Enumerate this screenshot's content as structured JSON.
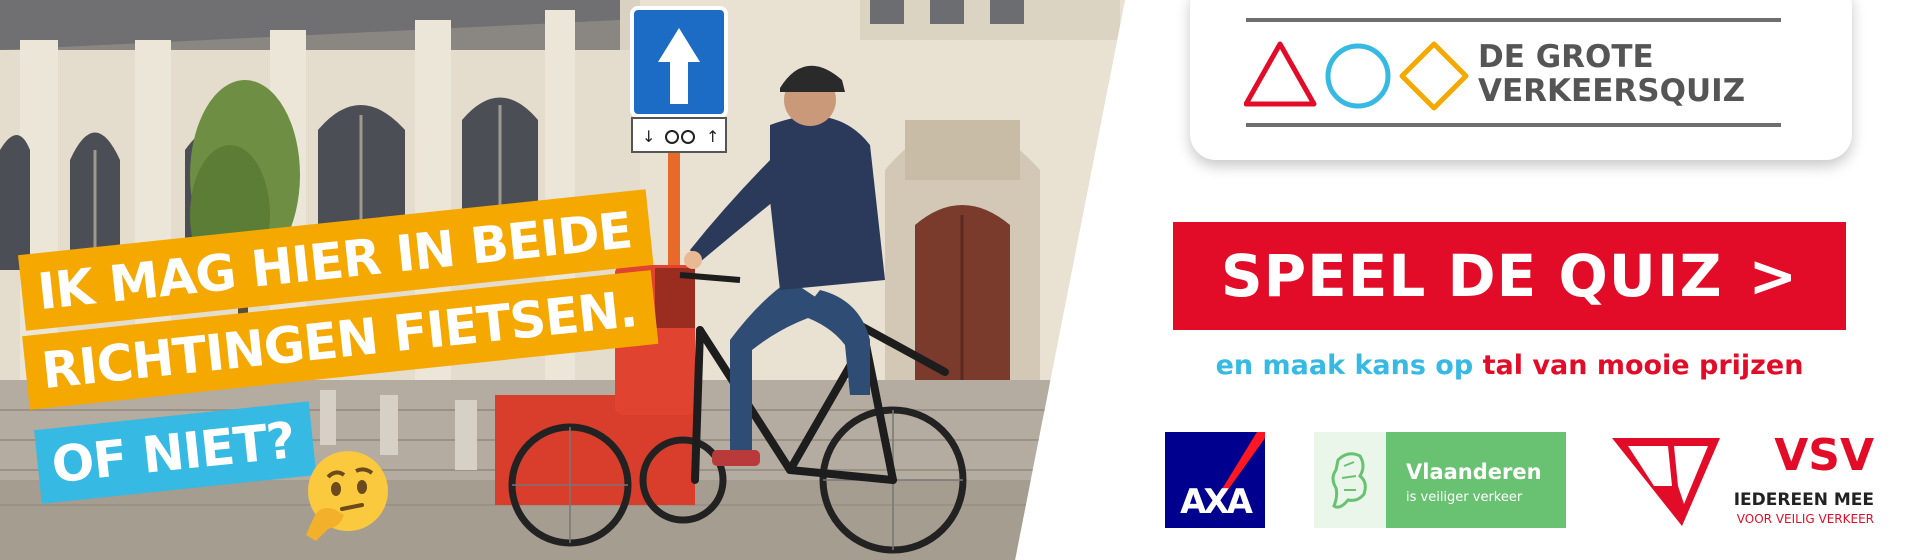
{
  "headline": {
    "line1": "IK MAG HIER IN BEIDE",
    "line2": "RICHTINGEN FIETSEN.",
    "line3": "OF NIET?",
    "emoji": "thinking-face"
  },
  "logo": {
    "line1": "DE GROTE",
    "line2": "VERKEERSQUIZ",
    "shapes": [
      "triangle",
      "circle",
      "diamond"
    ]
  },
  "cta": {
    "label": "SPEEL DE QUIZ",
    "chevron": ">"
  },
  "tagline": {
    "part1": "en maak kans op",
    "part2": "tal van mooie prijzen"
  },
  "sponsors": {
    "axa": "AXA",
    "vlaanderen": {
      "title": "Vlaanderen",
      "subtitle": "is veiliger verkeer"
    },
    "vsv": {
      "title": "VSV",
      "line1": "IEDEREEN MEE",
      "line2": "VOOR VEILIG VERKEER"
    }
  },
  "colors": {
    "yellow": "#f5a800",
    "blue": "#36b9e2",
    "red": "#e20c28",
    "grey": "#555555",
    "axa_blue": "#00008f",
    "vlaanderen_green": "#68c272"
  }
}
